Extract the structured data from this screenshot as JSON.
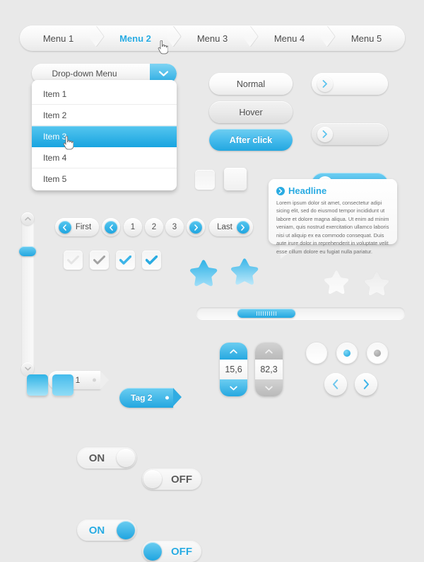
{
  "menu": {
    "items": [
      {
        "label": "Menu 1",
        "active": false
      },
      {
        "label": "Menu 2",
        "active": true
      },
      {
        "label": "Menu 3",
        "active": false
      },
      {
        "label": "Menu 4",
        "active": false
      },
      {
        "label": "Menu 5",
        "active": false
      }
    ]
  },
  "dropdown": {
    "label": "Drop-down Menu",
    "arrow_icon": "chevron-down-icon",
    "items": [
      {
        "label": "Item 1",
        "selected": false
      },
      {
        "label": "Item 2",
        "selected": false
      },
      {
        "label": "Item 3",
        "selected": true
      },
      {
        "label": "Item 4",
        "selected": false
      },
      {
        "label": "Item 5",
        "selected": false
      }
    ]
  },
  "buttons": {
    "normal": "Normal",
    "hover": "Hover",
    "after_click": "After click",
    "arrow_icon": "chevron-right-icon"
  },
  "tooltip": {
    "headline": "Headline",
    "headline_icon": "chevron-right-circle-icon",
    "body": "Lorem ipsum dolor sit amet, consectetur adipi sicing elit, sed do eiusmod tempor incididunt ut labore et dolore magna aliqua. Ut enim ad minim veniam, quis nostrud exercitation ullamco laboris nisi ut aliquip ex ea commodo consequat. Duis aute irure dolor in reprehenderit in voluptate velit esse cillum dolore eu fugiat nulla pariatur."
  },
  "pagination": {
    "first": "First",
    "last": "Last",
    "pages": [
      "1",
      "2",
      "3"
    ],
    "prev_icon": "chevron-left-icon",
    "next_icon": "chevron-right-icon"
  },
  "checkboxes": [
    {
      "state": "faint",
      "icon": "check-icon"
    },
    {
      "state": "grey",
      "icon": "check-icon"
    },
    {
      "state": "blue",
      "icon": "check-icon"
    },
    {
      "state": "blue-bold",
      "icon": "check-icon"
    }
  ],
  "stars": [
    {
      "color": "#2fb3e6",
      "name": "star-blue"
    },
    {
      "color": "#6ac9f0",
      "name": "star-blue"
    },
    {
      "color": "#f2f2f2",
      "name": "star-grey"
    },
    {
      "color": "#ededed",
      "name": "star-grey"
    }
  ],
  "tags": [
    {
      "label": "Tag 1",
      "style": "grey"
    },
    {
      "label": "Tag 2",
      "style": "blue"
    }
  ],
  "scrollbars": {
    "horizontal": {
      "thumb_percent": 20,
      "thumb_left_percent": 20
    },
    "vertical": {
      "thumb_top_percent": 21,
      "up_icon": "chevron-up-icon",
      "down_icon": "chevron-down-icon"
    }
  },
  "toggles": [
    {
      "label": "ON",
      "state": "on",
      "style": "grey"
    },
    {
      "label": "OFF",
      "state": "off",
      "style": "grey"
    },
    {
      "label": "ON",
      "state": "on",
      "style": "blue"
    },
    {
      "label": "OFF",
      "state": "off",
      "style": "blue"
    }
  ],
  "steppers": [
    {
      "value": "15,6",
      "style": "blue",
      "up_icon": "chevron-up-icon",
      "down_icon": "chevron-down-icon"
    },
    {
      "value": "82,3",
      "style": "grey",
      "up_icon": "chevron-up-icon",
      "down_icon": "chevron-down-icon"
    }
  ],
  "radios": [
    {
      "state": "empty"
    },
    {
      "state": "blue"
    },
    {
      "state": "grey"
    }
  ],
  "round_nav": {
    "prev_icon": "chevron-left-icon",
    "next_icon": "chevron-right-icon"
  },
  "colors": {
    "accent": "#29abe2",
    "accent_light": "#6bcdf1",
    "background": "#e9e9e9",
    "text": "#4a4a4a"
  }
}
